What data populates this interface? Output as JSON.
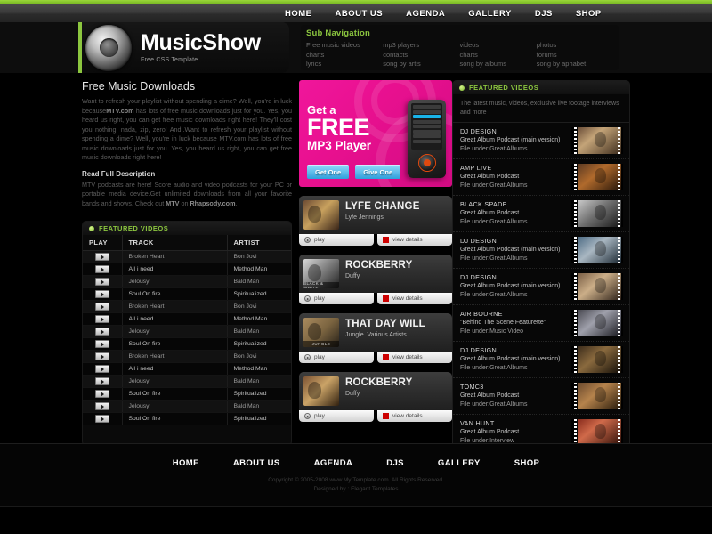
{
  "mainnav": {
    "items": [
      "HOME",
      "ABOUT US",
      "AGENDA",
      "GALLERY",
      "DJS",
      "SHOP"
    ]
  },
  "brand": {
    "title": "MusicShow",
    "tagline": "Free CSS Template"
  },
  "subnav": {
    "title": "Sub Navigation",
    "columns": [
      [
        "Free music videos",
        "charts",
        "lyrics"
      ],
      [
        "mp3 players",
        "contacts",
        "song by artis"
      ],
      [
        "videos",
        "charts",
        "song by albums"
      ],
      [
        "photos",
        "forums",
        "song by aphabet"
      ]
    ]
  },
  "intro": {
    "title": "Free Music Downloads",
    "body_1": "Want to refresh your playlist without spending a dime? Well, you're in luck because",
    "link_1": "MTV.com",
    "body_2": " has lots of free music downloads just for you. Yes, you heard us right, you can get free music downloads right here! They'll cost you nothing, nada, zip, zero! And..Want to refresh your playlist without spending a dime? Well, you're in luck because MTV.com has lots of free music downloads just for you. Yes, you heard us right, you can get free music downloads right here!",
    "subtitle": "Read Full Description",
    "body_3": "MTV podcasts are here! Score audio and video podcasts for your PC or portable media device.Get unlimited downloads from all your favorite bands and shows. Check out ",
    "link_2": "MTV",
    "body_4": " on ",
    "link_3": "Rhapsody.com",
    "body_5": "."
  },
  "featured_table": {
    "panel_title": "FEATURED VIDEOS",
    "headers": [
      "PLAY",
      "TRACK",
      "ARTIST"
    ],
    "rows": [
      {
        "track": "Broken Heart",
        "artist": "Bon Jovi"
      },
      {
        "track": "All i need",
        "artist": "Method Man"
      },
      {
        "track": "Jelousy",
        "artist": "Bald Man"
      },
      {
        "track": "Soul On fire",
        "artist": "Spiritualized"
      },
      {
        "track": "Broken Heart",
        "artist": "Bon Jovi"
      },
      {
        "track": "All i need",
        "artist": "Method Man"
      },
      {
        "track": "Jelousy",
        "artist": "Bald Man"
      },
      {
        "track": "Soul On fire",
        "artist": "Spiritualized"
      },
      {
        "track": "Broken Heart",
        "artist": "Bon Jovi"
      },
      {
        "track": "All i need",
        "artist": "Method Man"
      },
      {
        "track": "Jelousy",
        "artist": "Bald Man"
      },
      {
        "track": "Soul On fire",
        "artist": "Spiritualized"
      },
      {
        "track": "Jelousy",
        "artist": "Bald Man"
      },
      {
        "track": "Soul On fire",
        "artist": "Spiritualized"
      }
    ]
  },
  "promo": {
    "line1": "Get a",
    "line2": "FREE",
    "line3": "MP3 Player",
    "btn_get": "Get One",
    "btn_give": "Give One"
  },
  "video_cards": [
    {
      "title": "LYFE CHANGE",
      "artist": "Lyfe Jennings",
      "play": "play",
      "details": "view details",
      "thumb_label": ""
    },
    {
      "title": "ROCKBERRY",
      "artist": "Duffy",
      "play": "play",
      "details": "view details",
      "thumb_label": "BLACK & WHITE"
    },
    {
      "title": "THAT DAY WILL",
      "artist": "Jungle. Various Artists",
      "play": "play",
      "details": "view details",
      "thumb_label": "JUNGLE"
    },
    {
      "title": "ROCKBERRY",
      "artist": "Duffy",
      "play": "play",
      "details": "view details",
      "thumb_label": ""
    }
  ],
  "right_panel": {
    "panel_title": "FEATURED VIDEOS",
    "description": "The latest music, videos, exclusive live footage interviews and more",
    "items": [
      {
        "name": "DJ DESIGN",
        "desc": "Great Album Podcast (main version)",
        "file": "File under:Great Albums"
      },
      {
        "name": "AMP LIVE",
        "desc": "Great Album Podcast",
        "file": "File under:Great Albums"
      },
      {
        "name": "BLACK SPADE",
        "desc": "Great Album Podcast",
        "file": "File under:Great Albums"
      },
      {
        "name": "DJ DESIGN",
        "desc": "Great Album Podcast (main version)",
        "file": "File under:Great Albums"
      },
      {
        "name": "DJ DESIGN",
        "desc": "Great Album Podcast (main version)",
        "file": "File under:Great Albums"
      },
      {
        "name": "AIR BOURNE",
        "desc": "\"Behind The Scene Featurette\"",
        "file": "File under:Music Video"
      },
      {
        "name": "DJ DESIGN",
        "desc": "Great Album Podcast (main version)",
        "file": "File under:Great Albums"
      },
      {
        "name": "TOMC3",
        "desc": "Great Album Podcast",
        "file": "File under:Great Albums"
      },
      {
        "name": "VAN HUNT",
        "desc": "Great Album Podcast",
        "file": "File under:Interview"
      }
    ]
  },
  "footer": {
    "nav": [
      "HOME",
      "ABOUT US",
      "AGENDA",
      "DJS",
      "GALLERY",
      "SHOP"
    ],
    "copyright": "Copyright © 2005-2008 www.My Template.com. All Rights Reserved.",
    "designed": "Designed by : Elegant Templates"
  },
  "colors": {
    "accent_green": "#8cc63f",
    "promo_pink": "#e8108f",
    "details_red": "#cc0000",
    "background": "#000000"
  }
}
